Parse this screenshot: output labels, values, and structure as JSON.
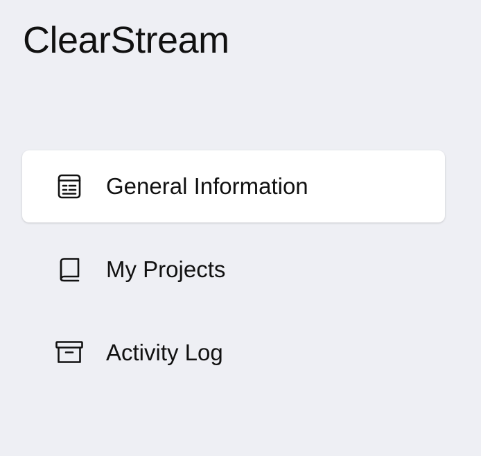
{
  "app": {
    "title": "ClearStream"
  },
  "nav": {
    "items": [
      {
        "label": "General Information",
        "icon": "document-text-icon",
        "active": true
      },
      {
        "label": "My Projects",
        "icon": "book-icon",
        "active": false
      },
      {
        "label": "Activity Log",
        "icon": "archive-box-icon",
        "active": false
      }
    ]
  },
  "colors": {
    "background": "#eeeff4",
    "active_item_background": "#ffffff",
    "text": "#111111"
  }
}
